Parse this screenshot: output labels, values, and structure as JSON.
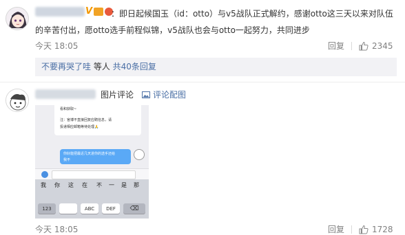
{
  "comment1": {
    "username_blur": "",
    "verified_badge": "V",
    "text_line1": "：即日起候国玉（id：otto）与v5战队正式解约，感谢otto这三天以来对队伍",
    "text_line2": "的辛苦付出，愿otto选手前程似锦，v5战队也会与otto一起努力，共同进步",
    "time": "今天 18:05",
    "reply_label": "回复",
    "like_count": "2345"
  },
  "reply_bar": {
    "first_reply_user": "不要再哭了哇",
    "middle_text": " 等人 ",
    "total_replies": "共40条回复"
  },
  "comment2": {
    "tag": "图片评论",
    "image_comment_link": "评论配图",
    "time": "今天 18:05",
    "reply_label": "回复",
    "like_count": "1728"
  },
  "screenshot": {
    "notice_line1": "看和获取~",
    "notice_line2": "注：官博不直接回复应聘信息，请",
    "notice_line3": "投递相应邮箱等待处理🙏",
    "bubble_line1": "你好能把最近几天进你的选手还给",
    "bubble_line2": "我不",
    "candidates": [
      "我",
      "你",
      "这",
      "在",
      "不",
      "一",
      "是",
      "那"
    ],
    "keys_row": [
      "123",
      "",
      "ABC",
      "DEF",
      "⌫"
    ]
  },
  "colors": {
    "accent_orange": "#eb7350",
    "link_blue": "#4a6fa5",
    "bar_bg": "#f2f2f5"
  }
}
